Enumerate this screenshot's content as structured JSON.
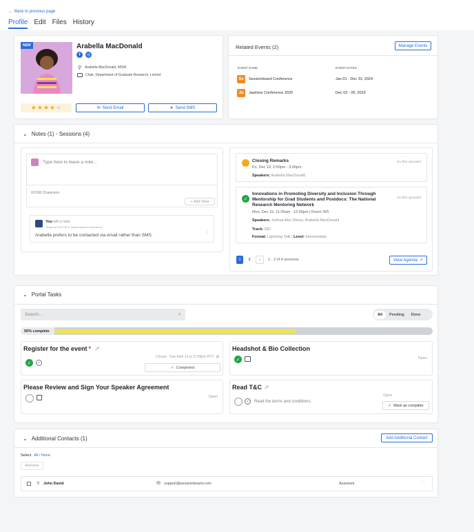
{
  "nav": {
    "back_label": "Back to previous page",
    "tabs": [
      {
        "label": "Profile",
        "active": true
      },
      {
        "label": "Edit"
      },
      {
        "label": "Files"
      },
      {
        "label": "History"
      }
    ]
  },
  "profile": {
    "new_badge": "NEW",
    "name": "Arabella MacDonald",
    "credentials": "Arabella MacDonald, MSW",
    "role": "Chair, Department of Graduate Research, Lemnd",
    "rating": 4,
    "rating_max": 5,
    "send_email_label": "Send Email",
    "send_sms_label": "Send SMS"
  },
  "related_events": {
    "title": "Related Events (2)",
    "manage_label": "Manage Events",
    "col_name": "EVENT NAME",
    "col_dates": "EVENT DATES",
    "events": [
      {
        "abbr": "Se",
        "name": "Sessionboard Conference",
        "dates": "Jan 01 - Dec 31, 2024"
      },
      {
        "abbr": "Ja",
        "name": "Jasmine Conference 2025",
        "dates": "Dec 02 - 05, 2023"
      }
    ]
  },
  "notes": {
    "title": "Notes (1) - Sessions (4)",
    "placeholder": "Type here to leave a note...",
    "char_count": "0/1000 Characters",
    "add_note_label": "+ Add Note",
    "note": {
      "author": "You",
      "action": "left a note",
      "meta": "Today at 6:00 PM in",
      "meta_event": "Sessionboard Conference",
      "text": "Arabella prefers to be contacted via email rather than SMS."
    }
  },
  "sessions": {
    "items": [
      {
        "title": "Closing Remarks",
        "time": "Fri, Dec 19, 2:00pm - 3:00pm",
        "speakers_label": "Speakers:",
        "speakers": "Arabella MacDonald",
        "files": "No files uploaded"
      },
      {
        "title": "Innovations in Promoting Diversity and Inclusion Through Mentorship for Grad Students and Postdocs: The National Research Mentoring Network",
        "time": "Mon, Dec 15, 11:00am - 12:00pm | Room 305",
        "speakers_label": "Speakers:",
        "speakers": "Joshua Abu-Shiraz, Arabella MacDonald",
        "track_label": "Track:",
        "track": "DEI",
        "format_label": "Format:",
        "format": "Lightning Talk",
        "level_label": "Level:",
        "level": "Intermediate",
        "files": "No files uploaded"
      }
    ],
    "pages": [
      "1",
      "2"
    ],
    "next": "›",
    "range": "1 - 2 of 4 sessions",
    "view_agenda_label": "View Agenda"
  },
  "portal": {
    "title": "Portal Tasks",
    "search_placeholder": "Search...",
    "filters": [
      "All",
      "Pending",
      "Done"
    ],
    "progress_label": "50% complete",
    "progress": 0.5,
    "tasks": [
      {
        "title": "Register for the event",
        "required": "*",
        "status_text": "Closed · Due April 14 at 11:59pm PDT",
        "completed_label": "Completed"
      },
      {
        "title": "Headshot & Bio Collection",
        "status": "Open"
      },
      {
        "title": "Please Review and Sign Your Speaker Agreement",
        "status": "Open"
      },
      {
        "title": "Read T&C",
        "desc": "Read the terms and conditions.",
        "status": "Open",
        "mark_label": "Mark as complete"
      }
    ]
  },
  "contacts": {
    "title": "Additional Contacts (1)",
    "add_label": "Add Additional Contact",
    "select_label": "Select",
    "all_none": "All / None",
    "remove_label": "Remove",
    "rows": [
      {
        "name": "John David",
        "email": "support@sessionboard.com",
        "role": "Assistant",
        "menu": "···"
      }
    ]
  },
  "colors": {
    "accent": "#2b6cd8",
    "success": "#22a447",
    "progress": "#f2e64a",
    "star": "#f2a91f",
    "event_badge": "#f08a24"
  }
}
